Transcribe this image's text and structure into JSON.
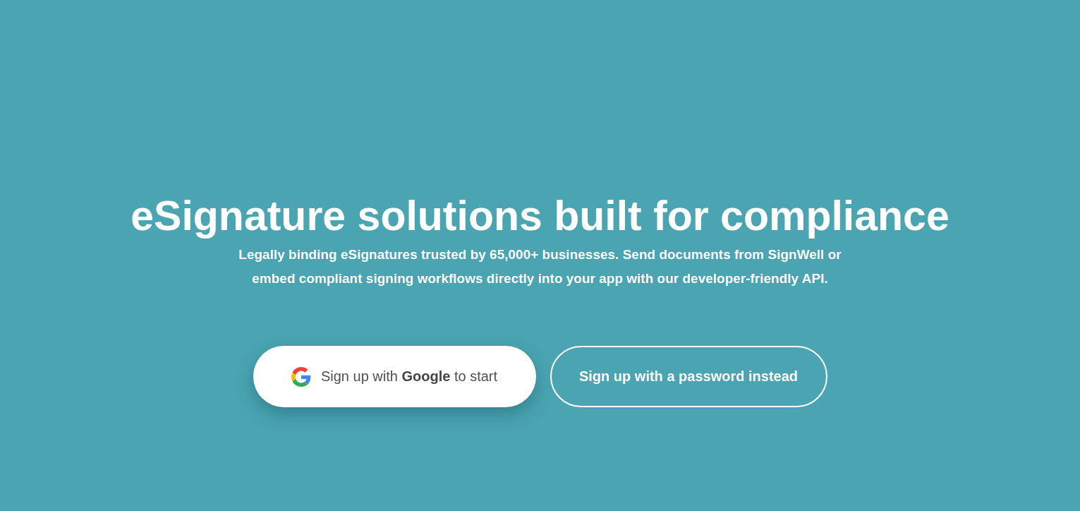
{
  "hero": {
    "title": "eSignature solutions built for compliance",
    "subtitle": "Legally binding eSignatures trusted by 65,000+ businesses. Send documents from SignWell or embed compliant signing workflows directly into your app with our developer-friendly API.",
    "buttons": [
      {
        "kind": "google",
        "label": "Sign up with **Google** to start"
      },
      {
        "kind": "outline",
        "label": "Sign up with a password instead"
      }
    ]
  }
}
